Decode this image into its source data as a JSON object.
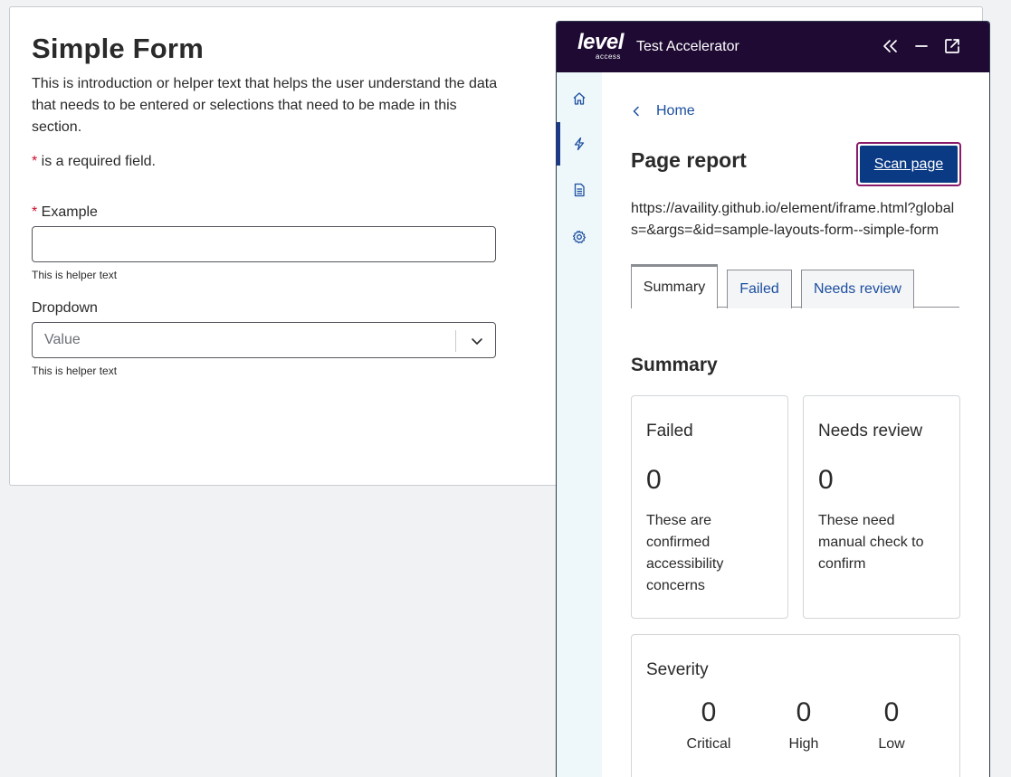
{
  "form": {
    "title": "Simple Form",
    "intro": "This is introduction or helper text that helps the user understand the data that needs to be entered or selections that need to be made in this section.",
    "required_star": "*",
    "required_note": " is a required field.",
    "example": {
      "star": "*",
      "label": " Example",
      "value": "",
      "helper": "This is helper text"
    },
    "dropdown": {
      "label": "Dropdown",
      "value": "Value",
      "helper": "This is helper text"
    }
  },
  "panel": {
    "logo_main": "level",
    "logo_sub": "access",
    "app_title": "Test Accelerator",
    "header_icons": [
      "collapse-left-icon",
      "minimize-icon",
      "popout-icon"
    ],
    "rail": [
      "home-icon",
      "lightning-icon",
      "report-icon",
      "settings-icon"
    ],
    "breadcrumb": "Home",
    "page_title": "Page report",
    "scan_button": "Scan page",
    "url": "https://availity.github.io/element/iframe.html?globals=&args=&id=sample-layouts-form--simple-form",
    "tabs": [
      "Summary",
      "Failed",
      "Needs review"
    ],
    "summary_heading": "Summary",
    "cards": {
      "failed": {
        "title": "Failed",
        "count": "0",
        "desc": "These are confirmed accessibility concerns"
      },
      "review": {
        "title": "Needs review",
        "count": "0",
        "desc": "These need manual check to confirm"
      }
    },
    "severity": {
      "title": "Severity",
      "items": [
        {
          "count": "0",
          "label": "Critical"
        },
        {
          "count": "0",
          "label": "High"
        },
        {
          "count": "0",
          "label": "Low"
        }
      ]
    }
  },
  "colors": {
    "header_bg": "#1e0a33",
    "link": "#1b4ea0",
    "primary_button": "#0a3a84",
    "focus_ring": "#8a1b6b",
    "required": "#c8102e",
    "rail_bg": "#eef7fa"
  }
}
